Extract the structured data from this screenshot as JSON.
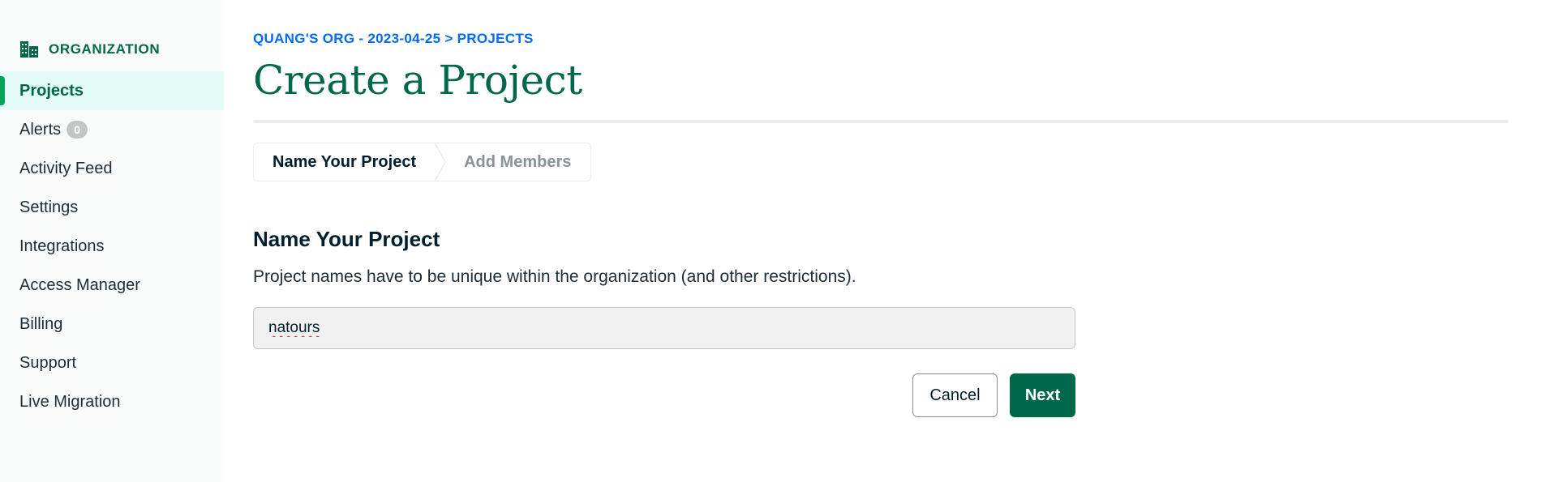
{
  "sidebar": {
    "header": {
      "icon": "building-icon",
      "title": "ORGANIZATION"
    },
    "items": [
      {
        "label": "Projects",
        "active": true
      },
      {
        "label": "Alerts",
        "badge": "0"
      },
      {
        "label": "Activity Feed"
      },
      {
        "label": "Settings"
      },
      {
        "label": "Integrations"
      },
      {
        "label": "Access Manager"
      },
      {
        "label": "Billing"
      },
      {
        "label": "Support"
      },
      {
        "label": "Live Migration"
      }
    ]
  },
  "main": {
    "breadcrumb": "QUANG'S ORG - 2023-04-25 > PROJECTS",
    "title": "Create a Project",
    "steps": [
      {
        "label": "Name Your Project",
        "state": "current"
      },
      {
        "label": "Add Members",
        "state": "upcoming"
      }
    ],
    "section": {
      "title": "Name Your Project",
      "description": "Project names have to be unique within the organization (and other restrictions).",
      "input_value": "natours"
    },
    "actions": {
      "cancel_label": "Cancel",
      "next_label": "Next"
    }
  },
  "colors": {
    "accent": "#00684a",
    "accent_bright": "#00a35c",
    "active_bg": "#e3fcf7",
    "link": "#016bf8"
  }
}
